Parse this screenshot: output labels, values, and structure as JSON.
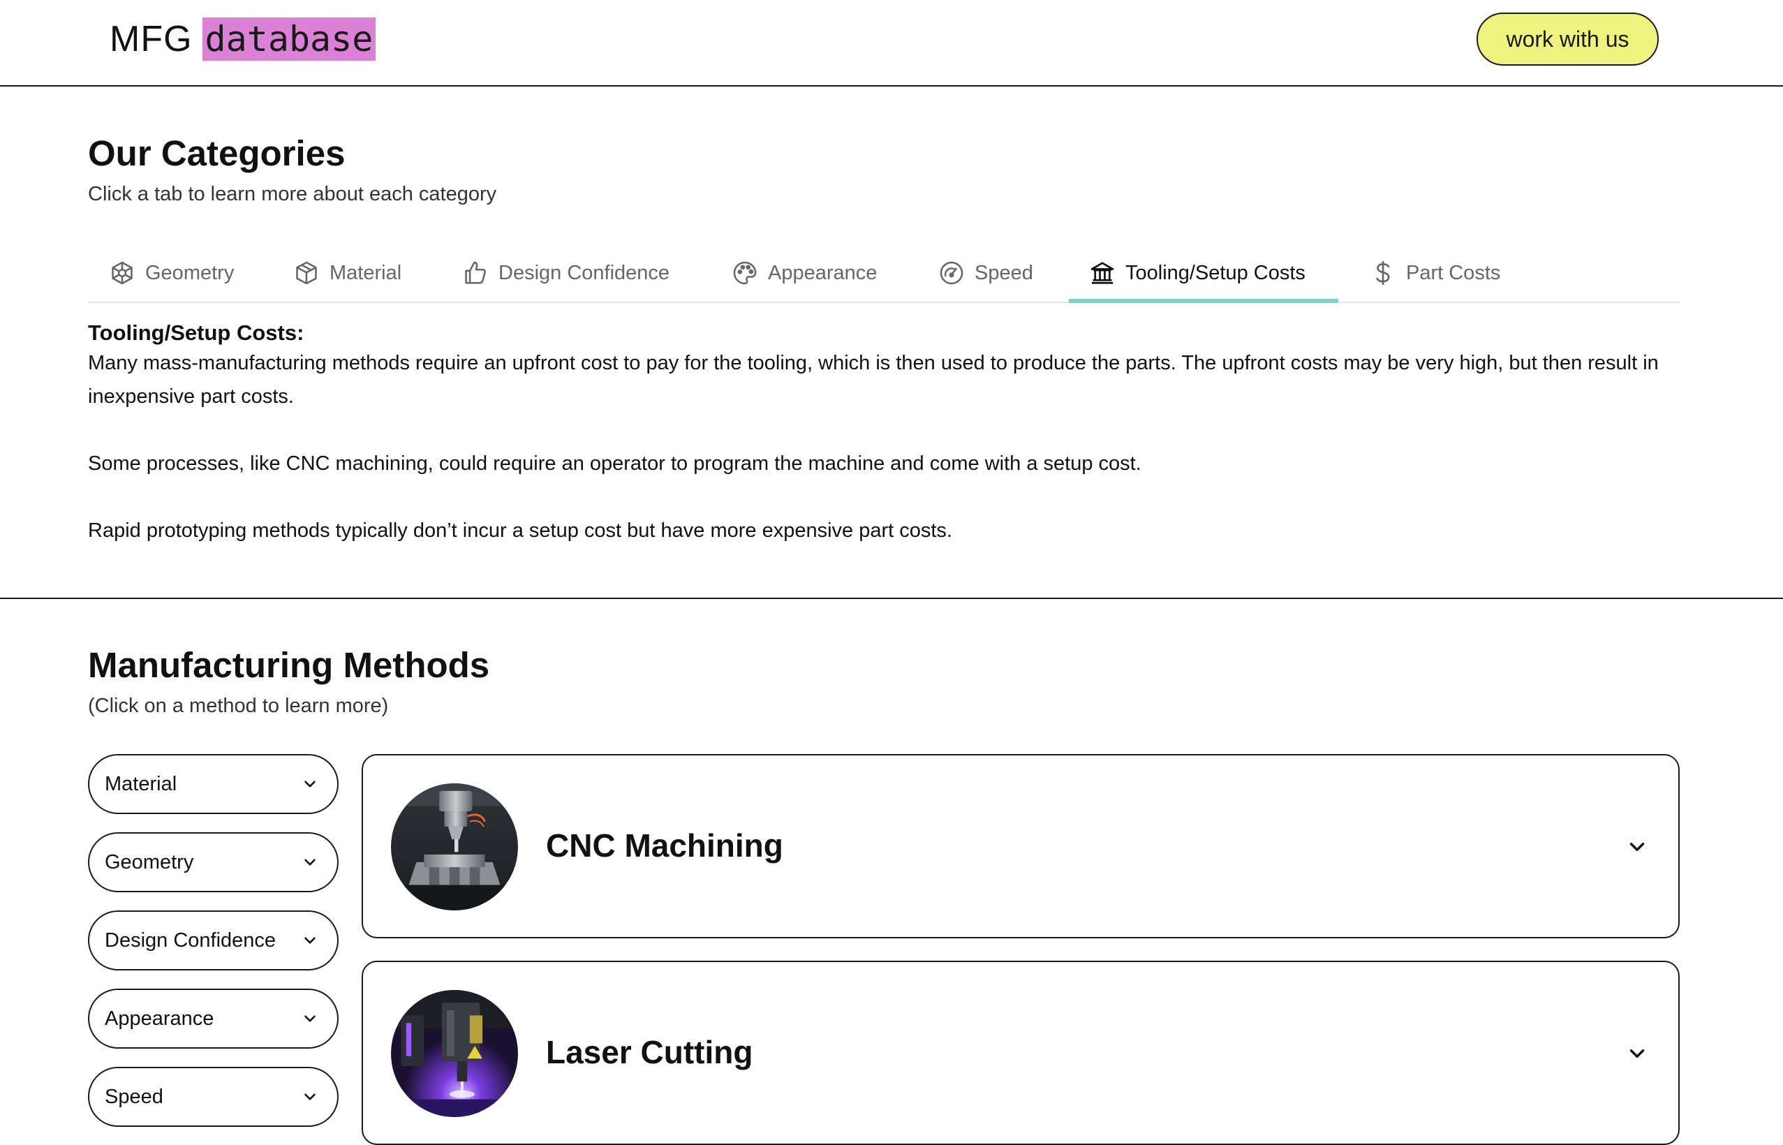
{
  "header": {
    "logo_text": "MFG",
    "logo_mark": "database",
    "cta_label": "work with us",
    "colors": {
      "logo_highlight": "#dc82d6",
      "cta_background": "#eef27f"
    }
  },
  "categories": {
    "title": "Our Categories",
    "subtitle": "Click a tab to learn more about each category",
    "tabs": [
      {
        "label": "Geometry",
        "icon": "cube-wireframe-icon",
        "active": false
      },
      {
        "label": "Material",
        "icon": "box-icon",
        "active": false
      },
      {
        "label": "Design Confidence",
        "icon": "thumbs-up-icon",
        "active": false
      },
      {
        "label": "Appearance",
        "icon": "palette-icon",
        "active": false
      },
      {
        "label": "Speed",
        "icon": "gauge-icon",
        "active": false
      },
      {
        "label": "Tooling/Setup Costs",
        "icon": "bank-icon",
        "active": true
      },
      {
        "label": "Part Costs",
        "icon": "dollar-icon",
        "active": false
      }
    ],
    "active_underline_color": "#7fd1cc",
    "panel": {
      "title": "Tooling/Setup Costs:",
      "paragraphs": [
        "Many mass-manufacturing methods require an upfront cost to pay for the tooling, which is then used to produce the parts. The upfront costs may be very high, but then result in inexpensive part costs.",
        "Some processes, like CNC machining, could require an operator to program the machine and come with a setup cost.",
        "Rapid prototyping methods typically don’t incur a setup cost but have more expensive part costs."
      ]
    }
  },
  "methods": {
    "title": "Manufacturing Methods",
    "subtitle": "(Click on a method to learn more)",
    "filters": [
      {
        "label": "Material"
      },
      {
        "label": "Geometry"
      },
      {
        "label": "Design Confidence"
      },
      {
        "label": "Appearance"
      },
      {
        "label": "Speed"
      }
    ],
    "cards": [
      {
        "title": "CNC Machining",
        "image": "cnc-machine-photo"
      },
      {
        "title": "Laser Cutting",
        "image": "laser-cutter-photo"
      }
    ]
  }
}
